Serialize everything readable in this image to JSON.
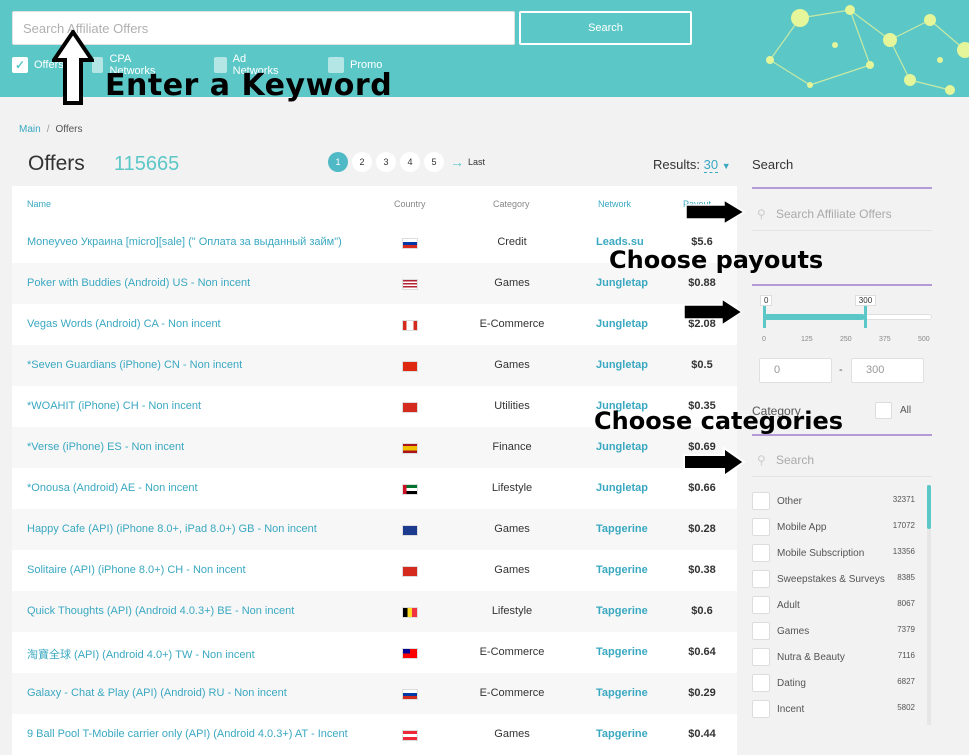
{
  "search": {
    "placeholder": "Search Affiliate Offers",
    "button_label": "Search"
  },
  "filters": [
    {
      "label": "Offers",
      "checked": true
    },
    {
      "label": "CPA Networks",
      "checked": false
    },
    {
      "label": "Ad Networks",
      "checked": false
    },
    {
      "label": "Promo",
      "checked": false
    }
  ],
  "annotations": {
    "keyword": "Enter a Keyword",
    "payouts": "Choose payouts",
    "categories": "Choose categories"
  },
  "breadcrumb": {
    "main": "Main",
    "current": "Offers"
  },
  "offers": {
    "title": "Offers",
    "count": "115665"
  },
  "pager": {
    "pages": [
      "1",
      "2",
      "3",
      "4",
      "5"
    ],
    "active": "1",
    "last": "Last"
  },
  "results": {
    "label": "Results:",
    "value": "30"
  },
  "table": {
    "headers": {
      "name": "Name",
      "country": "Country",
      "category": "Category",
      "network": "Network",
      "payout": "Payout"
    },
    "rows": [
      {
        "name": "Moneyveo Украина [micro][sale] (\" Оплата за выданный займ\")",
        "flag": "RU",
        "category": "Credit",
        "network": "Leads.su",
        "payout": "$5.6"
      },
      {
        "name": "Poker with Buddies (Android) US - Non incent",
        "flag": "US",
        "category": "Games",
        "network": "Jungletap",
        "payout": "$0.88"
      },
      {
        "name": "Vegas Words (Android) CA - Non incent",
        "flag": "CA",
        "category": "E-Commerce",
        "network": "Jungletap",
        "payout": "$2.08"
      },
      {
        "name": "*Seven Guardians (iPhone) CN - Non incent",
        "flag": "CN",
        "category": "Games",
        "network": "Jungletap",
        "payout": "$0.5"
      },
      {
        "name": "*WOAHIT (iPhone) CH - Non incent",
        "flag": "CH",
        "category": "Utilities",
        "network": "Jungletap",
        "payout": "$0.35"
      },
      {
        "name": "*Verse (iPhone) ES - Non incent",
        "flag": "ES",
        "category": "Finance",
        "network": "Jungletap",
        "payout": "$0.69"
      },
      {
        "name": "*Onousa (Android) AE - Non incent",
        "flag": "AE",
        "category": "Lifestyle",
        "network": "Jungletap",
        "payout": "$0.66"
      },
      {
        "name": "Happy Cafe (API) (iPhone 8.0+, iPad 8.0+) GB - Non incent",
        "flag": "GB",
        "category": "Games",
        "network": "Tapgerine",
        "payout": "$0.28"
      },
      {
        "name": "Solitaire (API) (iPhone 8.0+) CH - Non incent",
        "flag": "CH",
        "category": "Games",
        "network": "Tapgerine",
        "payout": "$0.38"
      },
      {
        "name": "Quick Thoughts (API) (Android 4.0.3+) BE - Non incent",
        "flag": "BE",
        "category": "Lifestyle",
        "network": "Tapgerine",
        "payout": "$0.6"
      },
      {
        "name": "淘寶全球 (API) (Android 4.0+) TW - Non incent",
        "flag": "TW",
        "category": "E-Commerce",
        "network": "Tapgerine",
        "payout": "$0.64"
      },
      {
        "name": "Galaxy - Chat & Play (API) (Android) RU - Non incent",
        "flag": "RU",
        "category": "E-Commerce",
        "network": "Tapgerine",
        "payout": "$0.29"
      },
      {
        "name": "9 Ball Pool T-Mobile carrier only (API) (Android 4.0.3+) AT - Incent",
        "flag": "AT",
        "category": "Games",
        "network": "Tapgerine",
        "payout": "$0.44"
      }
    ]
  },
  "sidebar": {
    "search_title": "Search",
    "search_placeholder": "Search Affiliate Offers",
    "payout": {
      "min_label": "0",
      "max_label": "300",
      "ticks": [
        "0",
        "125",
        "250",
        "375",
        "500"
      ],
      "min_value": "0",
      "max_value": "300",
      "range_min": 0,
      "range_max": 500,
      "selected_min": 0,
      "selected_max": 300
    },
    "category_title": "Category",
    "all_label": "All",
    "category_search_placeholder": "Search",
    "categories": [
      {
        "label": "Other",
        "count": "32371"
      },
      {
        "label": "Mobile App",
        "count": "17072"
      },
      {
        "label": "Mobile Subscription",
        "count": "13356"
      },
      {
        "label": "Sweepstakes & Surveys",
        "count": "8385"
      },
      {
        "label": "Adult",
        "count": "8067"
      },
      {
        "label": "Games",
        "count": "7379"
      },
      {
        "label": "Nutra & Beauty",
        "count": "7116"
      },
      {
        "label": "Dating",
        "count": "6827"
      },
      {
        "label": "Incent",
        "count": "5802"
      }
    ]
  },
  "colors": {
    "teal": "#5cc7c7",
    "link": "#3aa8c1",
    "accent_line": "#b59ad8"
  }
}
